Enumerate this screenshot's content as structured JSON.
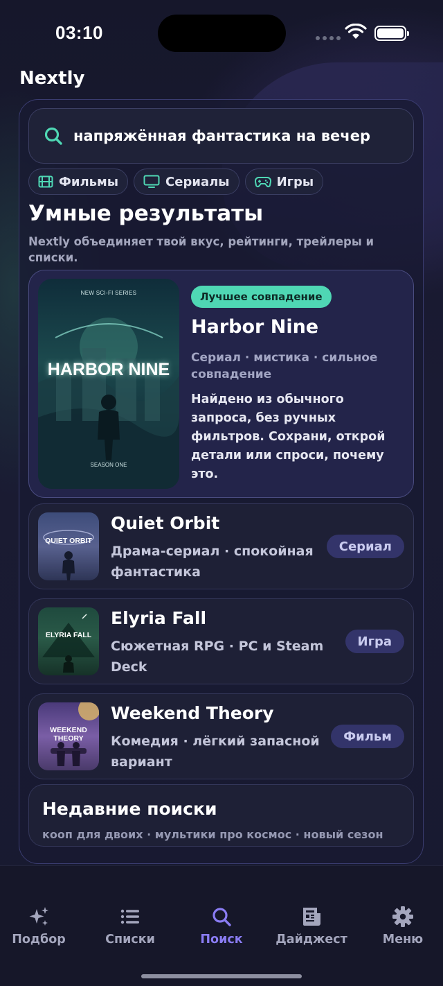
{
  "status_bar": {
    "time": "03:10"
  },
  "app": {
    "title": "Nextly"
  },
  "search": {
    "value": "напряжённая фантастика на вечер"
  },
  "chips": [
    {
      "label": "Фильмы",
      "icon": "film-icon"
    },
    {
      "label": "Сериалы",
      "icon": "tv-icon"
    },
    {
      "label": "Игры",
      "icon": "gamepad-icon"
    }
  ],
  "section": {
    "title": "Умные результаты",
    "subtitle": "Nextly объединяет твой вкус, рейтинги, трейлеры и списки."
  },
  "hero": {
    "badge": "Лучшее совпадение",
    "title": "Harbor Nine",
    "meta": "Сериал · мистика · сильное совпадение",
    "description": "Найдено из обычного запроса, без ручных фильтров. Сохрани, открой детали или спроси, почему это.",
    "poster": {
      "top": "NEW SCI-FI SERIES",
      "title": "HARBOR NINE",
      "bottom": "SEASON ONE"
    }
  },
  "results": [
    {
      "title": "Quiet Orbit",
      "subtitle": "Драма-сериал · спокойная фантастика",
      "type": "Сериал",
      "thumb_text": "QUIET ORBIT"
    },
    {
      "title": "Elyria Fall",
      "subtitle": "Сюжетная RPG · PC и Steam Deck",
      "type": "Игра",
      "thumb_text": "ELYRIA FALL"
    },
    {
      "title": "Weekend Theory",
      "subtitle": "Комедия · лёгкий запасной вариант",
      "type": "Фильм",
      "thumb_text": "WEEKEND THEORY"
    }
  ],
  "recent": {
    "title": "Недавние поиски",
    "items": "кооп для двоих · мультики про космос · новый сезон"
  },
  "tabs": [
    {
      "label": "Подбор",
      "icon": "sparkles-icon",
      "active": false
    },
    {
      "label": "Списки",
      "icon": "list-icon",
      "active": false
    },
    {
      "label": "Поиск",
      "icon": "search-icon",
      "active": true
    },
    {
      "label": "Дайджест",
      "icon": "newspaper-icon",
      "active": false
    },
    {
      "label": "Меню",
      "icon": "gear-icon",
      "active": false
    }
  ],
  "colors": {
    "accent": "#8a7cf3",
    "best_match_badge": "#4fd7b4",
    "background": "#14162a",
    "search_icon": "#4fd7b4"
  }
}
